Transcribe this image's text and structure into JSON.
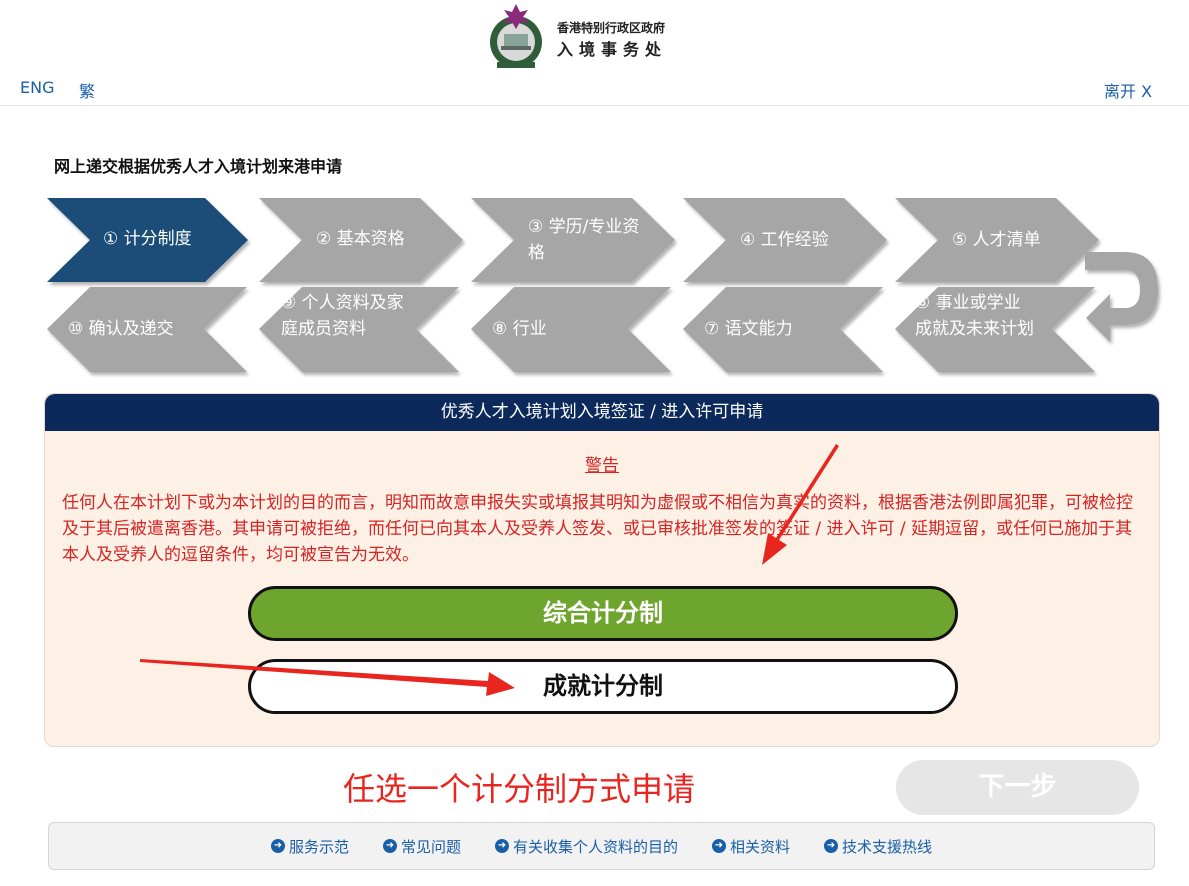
{
  "header": {
    "gov_name": "香港特别行政区政府",
    "dept_name": "入境事务处",
    "lang_eng": "ENG",
    "lang_trad": "繁",
    "leave_label": "离开 X"
  },
  "page_title": "网上递交根据优秀人才入境计划来港申请",
  "steps": [
    {
      "label": "① 计分制度",
      "active": true
    },
    {
      "label": "② 基本资格"
    },
    {
      "label": "③ 学历/专业资格"
    },
    {
      "label": "④ 工作经验"
    },
    {
      "label": "⑤ 人才清单"
    },
    {
      "label": "⑥ 事业或学业成就及未来计划"
    },
    {
      "label": "⑦ 语文能力"
    },
    {
      "label": "⑧ 行业"
    },
    {
      "label": "⑨ 个人资料及家庭成员资料"
    },
    {
      "label": "⑩ 确认及递交"
    }
  ],
  "panel": {
    "heading": "优秀人才入境计划入境签证 / 进入许可申请",
    "warning_title": "警告",
    "warning_text": "任何人在本计划下或为本计划的目的而言，明知而故意申报失实或填报其明知为虚假或不相信为真实的资料，根据香港法例即属犯罪，可被检控及于其后被遣离香港。其申请可被拒绝，而任何已向其本人及受养人签发、或已审核批准签发的签证 / 进入许可 / 延期逗留，或任何已施加于其本人及受养人的逗留条件，均可被宣告为无效。",
    "btn_comprehensive": "综合计分制",
    "btn_achievement": "成就计分制"
  },
  "annotation_text": "任选一个计分制方式申请",
  "next_label": "下一步",
  "footer": {
    "links": [
      "服务示范",
      "常见问题",
      "有关收集个人资料的目的",
      "相关资料",
      "技术支援热线"
    ]
  },
  "colors": {
    "active_step": "#1f4e79",
    "inactive_step": "#a6a6a6",
    "panel_header": "#0b2a5b",
    "warning": "#d42424",
    "green_button": "#6ea52e",
    "link": "#1a5ea8"
  }
}
